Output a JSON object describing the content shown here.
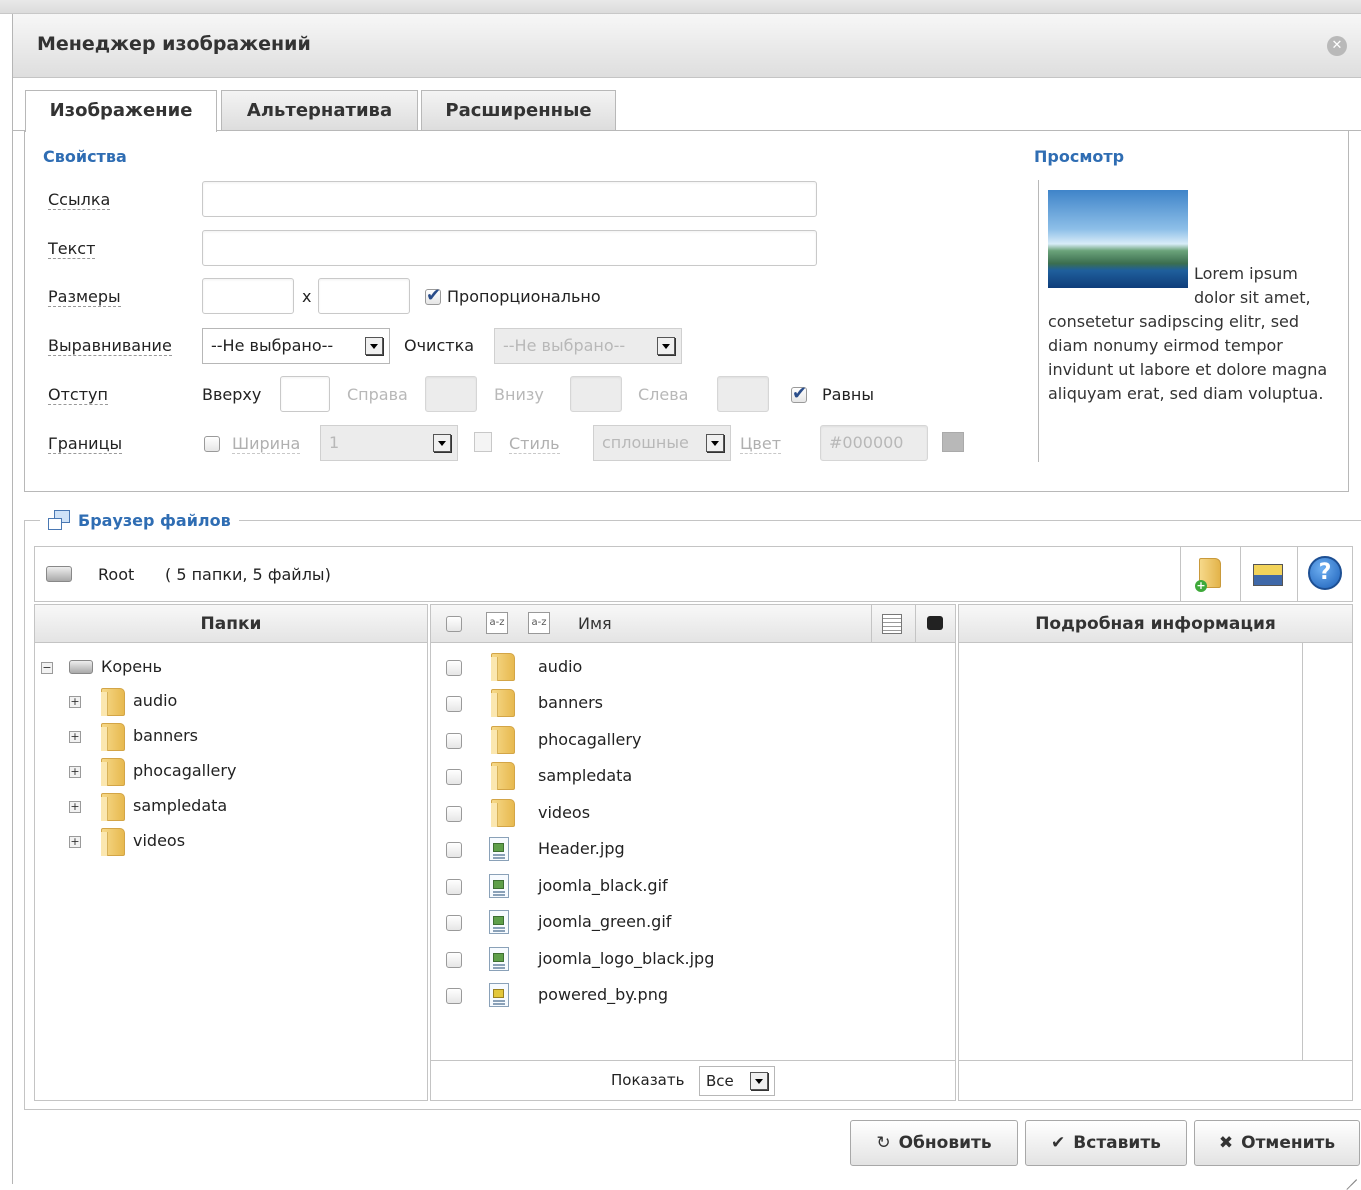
{
  "dialog": {
    "title": "Менеджер изображений"
  },
  "tabs": [
    {
      "label": "Изображение",
      "active": true
    },
    {
      "label": "Альтернатива",
      "active": false
    },
    {
      "label": "Расширенные",
      "active": false
    }
  ],
  "properties": {
    "heading": "Свойства",
    "link_label": "Ссылка",
    "link_value": "",
    "text_label": "Текст",
    "text_value": "",
    "size_label": "Размеры",
    "size_x": "x",
    "width_value": "",
    "height_value": "",
    "proportional_label": "Пропорционально",
    "proportional_checked": true,
    "align_label": "Выравнивание",
    "align_value": "--Не выбрано--",
    "clear_label": "Очистка",
    "clear_value": "--Не выбрано--",
    "margin_label": "Отступ",
    "margin_top_label": "Вверху",
    "margin_right_label": "Справа",
    "margin_bottom_label": "Внизу",
    "margin_left_label": "Слева",
    "equal_label": "Равны",
    "equal_checked": true,
    "border_label": "Границы",
    "border_checked": false,
    "border_width_label": "Ширина",
    "border_width_value": "1",
    "border_style_label": "Стиль",
    "border_style_value": "сплошные",
    "border_color_label": "Цвет",
    "border_color_value": "#000000"
  },
  "preview": {
    "heading": "Просмотр",
    "text": "Lorem ipsum dolor sit amet, consetetur sadipscing elitr, sed diam nonumy eirmod tempor invidunt ut labore et dolore magna aliquyam erat, sed diam voluptua."
  },
  "file_browser": {
    "heading": "Браузер файлов",
    "root_label": "Root",
    "root_summary": "( 5 папки, 5 файлы)",
    "folders_header": "Папки",
    "name_header": "Имя",
    "details_header": "Подробная информация",
    "tree_root": "Корень",
    "tree_folders": [
      "audio",
      "banners",
      "phocagallery",
      "sampledata",
      "videos"
    ],
    "items": [
      {
        "name": "audio",
        "type": "folder"
      },
      {
        "name": "banners",
        "type": "folder"
      },
      {
        "name": "phocagallery",
        "type": "folder"
      },
      {
        "name": "sampledata",
        "type": "folder"
      },
      {
        "name": "videos",
        "type": "folder"
      },
      {
        "name": "Header.jpg",
        "type": "image"
      },
      {
        "name": "joomla_black.gif",
        "type": "image"
      },
      {
        "name": "joomla_green.gif",
        "type": "image"
      },
      {
        "name": "joomla_logo_black.jpg",
        "type": "image"
      },
      {
        "name": "powered_by.png",
        "type": "image-png"
      }
    ],
    "show_label": "Показать",
    "show_value": "Все"
  },
  "buttons": {
    "refresh": "Обновить",
    "insert": "Вставить",
    "cancel": "Отменить"
  },
  "icons": {
    "refresh": "↻",
    "insert": "✔",
    "cancel": "✖",
    "help": "?"
  },
  "colors": {
    "accent": "#2f6db3"
  }
}
